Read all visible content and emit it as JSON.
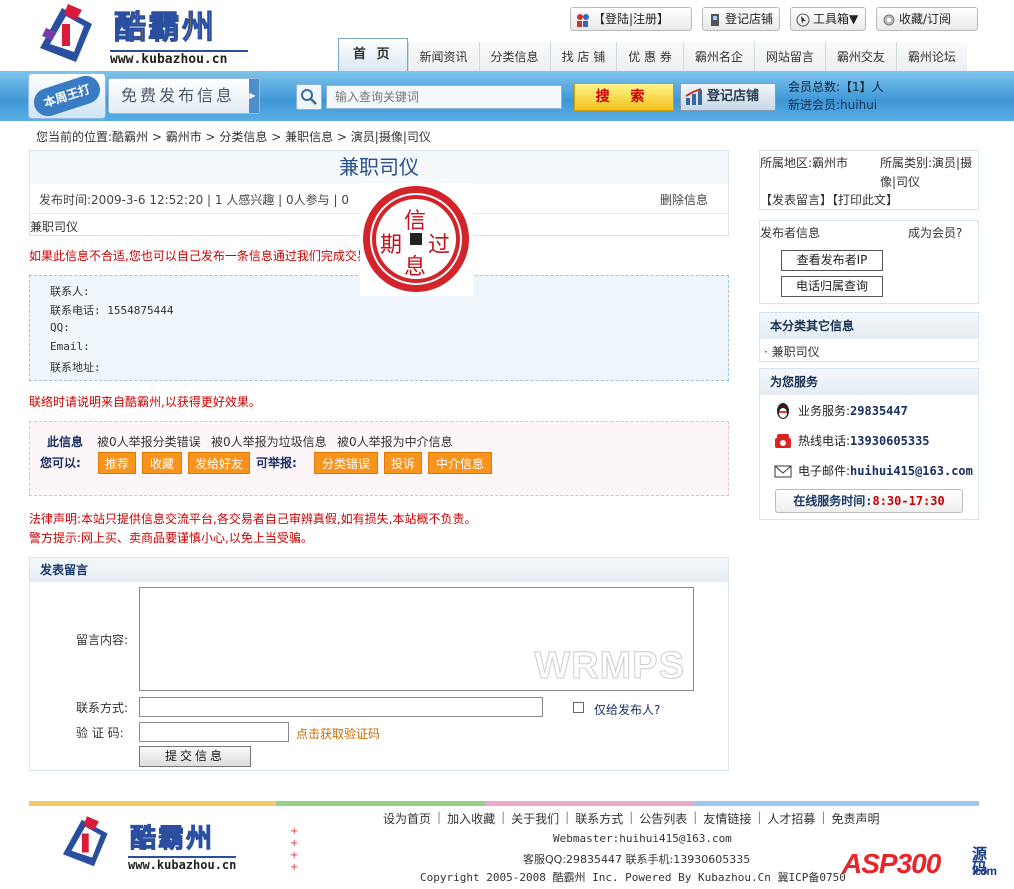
{
  "header": {
    "logo_title": "酷霸州",
    "logo_url": "www.kubazhou.cn",
    "top_buttons": [
      "【登陆|注册】",
      "登记店铺",
      "工具箱▼",
      "收藏/订阅"
    ],
    "nav": [
      "首 页",
      "新闻资讯",
      "分类信息",
      "找 店 铺",
      "优 惠 券",
      "霸州名企",
      "网站留言",
      "霸州交友",
      "霸州论坛"
    ]
  },
  "band": {
    "badge": "本周王打",
    "free_post": "免费发布信息",
    "search_placeholder": "输入查询关键词",
    "search_button": "搜 索",
    "register_shop": "登记店铺",
    "member_total": "会员总数:【1】人",
    "new_member": "新进会员:huihui"
  },
  "breadcrumb": "您当前的位置:酷霸州 > 霸州市 > 分类信息 > 兼职信息 > 演员|摄像|司仪",
  "post": {
    "title": "兼职司仪",
    "meta": "发布时间:2009-3-6 12:52:20 | 1 人感兴趣 | 0人参与 | 0",
    "delete": "删除信息",
    "category_line": "兼职司仪",
    "stamp_text": [
      "信",
      "过",
      "期",
      "息"
    ],
    "warning": "如果此信息不合适,您也可以自己发布一条信息通过我们完成交易。",
    "contact": [
      {
        "label": "联系人:",
        "value": ""
      },
      {
        "label": "联系电话:",
        "value": "1554875444"
      },
      {
        "label": "QQ:",
        "value": ""
      },
      {
        "label": "Email:",
        "value": ""
      },
      {
        "label": "联系地址:",
        "value": ""
      }
    ],
    "notice": "联络时请说明来自酷霸州,以获得更好效果。"
  },
  "report": {
    "this_info": "此信息",
    "reports": [
      "被0人举报分类错误",
      "被0人举报为垃圾信息",
      "被0人举报为中介信息"
    ],
    "you_can": "您可以:",
    "actions": [
      "推荐",
      "收藏",
      "发给好友"
    ],
    "can_report": "可举报:",
    "report_buttons": [
      "分类错误",
      "投诉",
      "中介信息"
    ]
  },
  "legal": {
    "statement": "法律声明:本站只提供信息交流平台,各交易者自己审辨真假,如有损失,本站概不负责。",
    "police": "警方提示:网上买、卖商品要谨慎小心,以免上当受骗。"
  },
  "message_form": {
    "heading": "发表留言",
    "content_label": "留言内容:",
    "watermark": "WRMPS",
    "contact_label": "联系方式:",
    "only_publisher": "仅给发布人?",
    "captcha_label": "验 证 码:",
    "captcha_link": "点击获取验证码",
    "submit": "提交信息"
  },
  "sidebar": {
    "region": "所属地区:霸州市",
    "category": "所属类别:演员|摄像|司仪",
    "links": "【发表留言】【打印此文】",
    "publisher_heading": "发布者信息",
    "become_member": "成为会员?",
    "view_ip": "查看发布者IP",
    "phone_lookup": "电话归属查询",
    "other_heading": "本分类其它信息",
    "other_items": [
      "· 兼职司仪"
    ],
    "service_heading": "为您服务",
    "service": [
      {
        "label": "业务服务:",
        "value": "29835447",
        "icon": "qq-icon"
      },
      {
        "label": "热线电话:",
        "value": "13930605335",
        "icon": "phone-icon"
      },
      {
        "label": "电子邮件:",
        "value": "huihui415@163.com",
        "icon": "mail-icon"
      }
    ],
    "online_label": "在线服务时间:",
    "online_time": "8:30-17:30"
  },
  "footer": {
    "links": [
      "设为首页",
      "加入收藏",
      "关于我们",
      "联系方式",
      "公告列表",
      "友情链接",
      "人才招募",
      "免责声明"
    ],
    "webmaster": "Webmaster:huihui415@163.com",
    "service_qq": "客服QQ:29835447 联系手机:13930605335",
    "copyright": "Copyright 2005-2008 酷霸州 Inc. Powered By Kubazhou.Cn 冀ICP备07502209",
    "asp_logo": "ASP300",
    "asp_code": "源码",
    "asp_domain": ".com"
  },
  "colors": {
    "accent": "#3e97d6",
    "warning": "#cc0000",
    "button_orange": "#f7941d"
  }
}
